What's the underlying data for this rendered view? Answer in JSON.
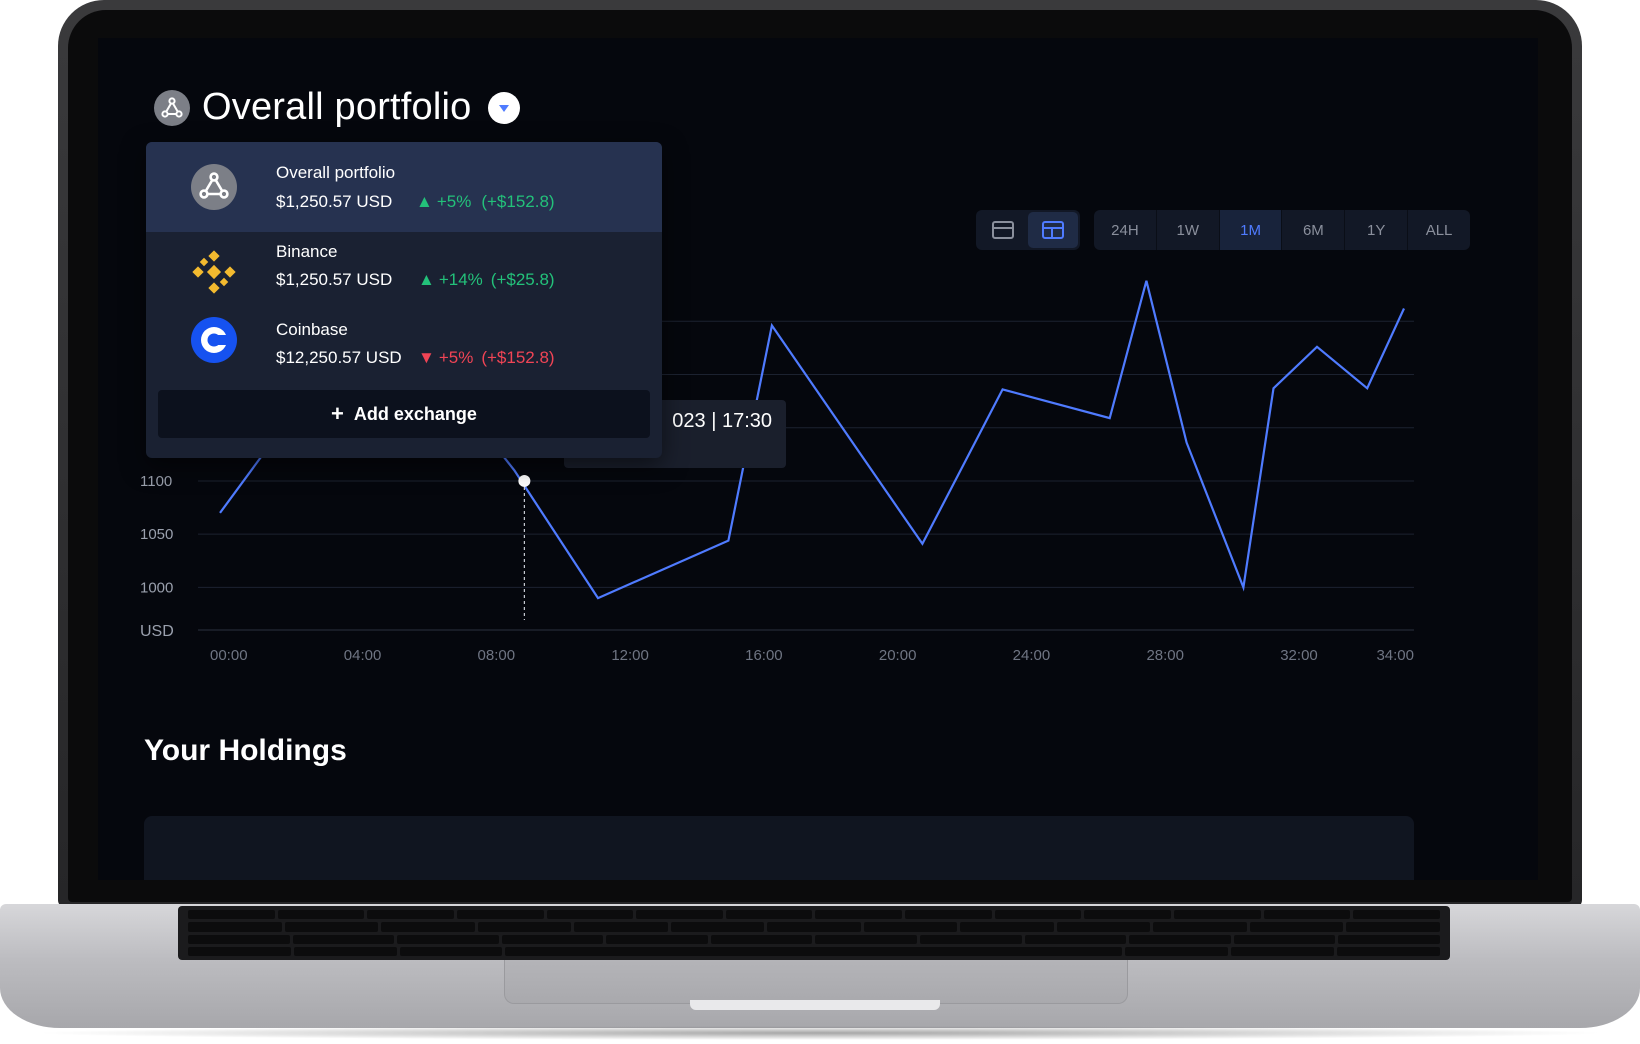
{
  "header": {
    "title": "Overall portfolio"
  },
  "view_toggle": {
    "active": "split-view"
  },
  "range_tabs": {
    "items": [
      "24H",
      "1W",
      "1M",
      "6M",
      "1Y",
      "ALL"
    ],
    "active": "1M"
  },
  "dropdown": {
    "items": [
      {
        "name": "Overall portfolio",
        "value": "$1,250.57 USD",
        "change": "+5%",
        "delta": "(+$152.8)",
        "direction": "up",
        "icon": "portfolio-icon"
      },
      {
        "name": "Binance",
        "value": "$1,250.57 USD",
        "change": "+14%",
        "delta": "(+$25.8)",
        "direction": "up",
        "icon": "binance-icon"
      },
      {
        "name": "Coinbase",
        "value": "$12,250.57 USD",
        "change": "+5%",
        "delta": "(+$152.8)",
        "direction": "down",
        "icon": "coinbase-icon"
      }
    ],
    "add_label": "Add exchange"
  },
  "tooltip": {
    "text": "023 | 17:30"
  },
  "holdings": {
    "title": "Your Holdings"
  },
  "colors": {
    "line": "#4f7bff",
    "up": "#23c17a",
    "down": "#f04455",
    "binance": "#f3ba2f",
    "coinbase": "#1652f0"
  },
  "chart_data": {
    "type": "line",
    "ylabel": "USD",
    "y_ticks": [
      1000,
      1050,
      1100
    ],
    "x_ticks": [
      "00:00",
      "04:00",
      "08:00",
      "12:00",
      "16:00",
      "20:00",
      "24:00",
      "28:00",
      "32:00",
      "34:00"
    ],
    "series": [
      {
        "values": [
          {
            "x": 0.3,
            "y": 1070
          },
          {
            "x": 1.7,
            "y": 1130
          },
          {
            "x": 8.6,
            "y": 1130
          },
          {
            "x": 9.1,
            "y": 1110
          },
          {
            "x": 11.6,
            "y": 990
          },
          {
            "x": 15.5,
            "y": 1044
          },
          {
            "x": 16.8,
            "y": 1246
          },
          {
            "x": 21.3,
            "y": 1041
          },
          {
            "x": 23.7,
            "y": 1186
          },
          {
            "x": 26.9,
            "y": 1159
          },
          {
            "x": 28.0,
            "y": 1288
          },
          {
            "x": 29.2,
            "y": 1136
          },
          {
            "x": 30.9,
            "y": 1000
          },
          {
            "x": 31.8,
            "y": 1187
          },
          {
            "x": 33.1,
            "y": 1226
          },
          {
            "x": 34.6,
            "y": 1187
          },
          {
            "x": 35.7,
            "y": 1262
          }
        ]
      }
    ],
    "hover_point": {
      "x": 9.4,
      "y": 1100
    },
    "ylim": [
      960,
      1300
    ],
    "xlim": [
      0,
      36
    ],
    "grid": true
  }
}
